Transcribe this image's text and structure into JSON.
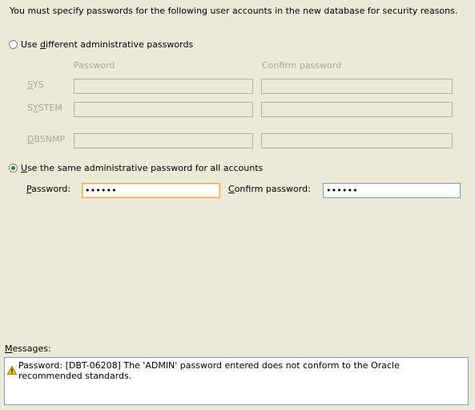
{
  "intro_text": "You must specify passwords for the following user accounts in the new database for security reasons.",
  "option_different": {
    "label": "Use different administrative passwords",
    "mnemonic": "d",
    "selected": false
  },
  "grid": {
    "col_password": "Password",
    "col_confirm": "Confirm password",
    "rows": [
      {
        "user": "SYS",
        "mnemonic": "S",
        "password": "",
        "confirm": ""
      },
      {
        "user": "SYSTEM",
        "mnemonic": "Y",
        "password": "",
        "confirm": ""
      },
      {
        "user": "DBSNMP",
        "mnemonic": "D",
        "password": "",
        "confirm": ""
      }
    ]
  },
  "option_same": {
    "label": "Use the same administrative password for all accounts",
    "mnemonic": "U",
    "selected": true
  },
  "same": {
    "password_label": "Password:",
    "password_value": "••••••",
    "confirm_label": "Confirm password:",
    "confirm_value": "••••••"
  },
  "messages": {
    "label": "Messages:",
    "text": "Password: [DBT-06208] The 'ADMIN' password entered does not conform to the Oracle recommended standards.",
    "icon": "warning-icon",
    "icon_color": "#f2c21b"
  },
  "colors": {
    "background": "#ece9d8",
    "focus_border": "#f7b038",
    "radio_dot": "#2d7a2d"
  }
}
